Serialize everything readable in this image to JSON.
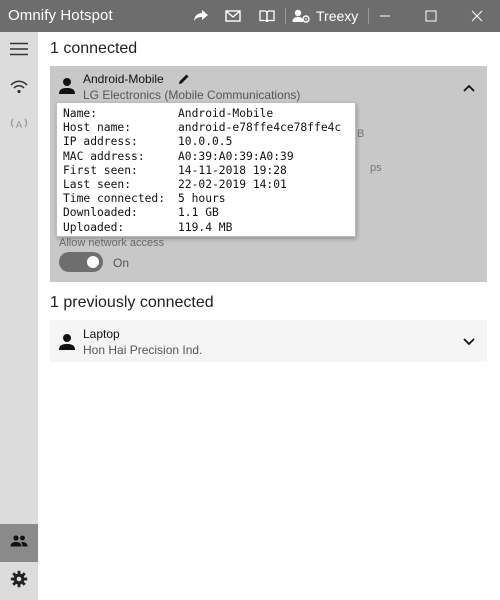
{
  "window": {
    "title": "Omnify Hotspot",
    "account": "Treexy"
  },
  "colors": {
    "titlebar": "#6d6d6d",
    "sidebar": "#dcdcdc",
    "sidebar_active": "#8a8a8a",
    "card_expanded": "#c8c8c8",
    "toggle": "#6e6e6e"
  },
  "sidebar": {
    "items": [
      {
        "icon": "hamburger-menu-icon"
      },
      {
        "icon": "wifi-icon"
      },
      {
        "icon": "antenna-icon"
      }
    ],
    "bottom": [
      {
        "icon": "people-icon",
        "active": true
      },
      {
        "icon": "gear-icon"
      }
    ]
  },
  "connected": {
    "title": "1 connected",
    "device": {
      "name": "Android-Mobile",
      "vendor": "LG Electronics (Mobile Communications)",
      "allow_label": "Allow network access",
      "toggle_state": "On",
      "obscured_text_1": "B",
      "obscured_text_2": "ps"
    }
  },
  "tooltip": {
    "rows": [
      {
        "key": "Name:",
        "value": "Android-Mobile"
      },
      {
        "key": "Host name:",
        "value": "android-e78ffe4ce78ffe4c"
      },
      {
        "key": "IP address:",
        "value": "10.0.0.5"
      },
      {
        "key": "MAC address:",
        "value": "A0:39:A0:39:A0:39"
      },
      {
        "key": "First seen:",
        "value": "14-11-2018 19:28"
      },
      {
        "key": "Last seen:",
        "value": "22-02-2019 14:01"
      },
      {
        "key": "Time connected:",
        "value": "5 hours"
      },
      {
        "key": "Downloaded:",
        "value": "1.1 GB"
      },
      {
        "key": "Uploaded:",
        "value": "119.4 MB"
      }
    ]
  },
  "previous": {
    "title": "1 previously connected",
    "device": {
      "name": "Laptop",
      "vendor": "Hon Hai Precision Ind."
    }
  }
}
